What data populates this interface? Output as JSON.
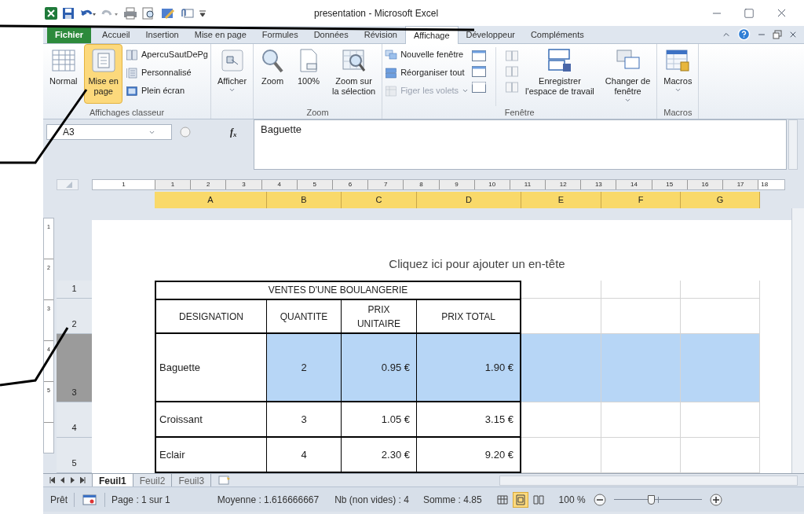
{
  "window": {
    "title": "presentation - Microsoft Excel"
  },
  "ribbon_tabs": [
    {
      "label": "Fichier",
      "kind": "file",
      "selected": false
    },
    {
      "label": "Accueil",
      "kind": "tab",
      "selected": false
    },
    {
      "label": "Insertion",
      "kind": "tab",
      "selected": false
    },
    {
      "label": "Mise en page",
      "kind": "tab",
      "selected": false
    },
    {
      "label": "Formules",
      "kind": "tab",
      "selected": false
    },
    {
      "label": "Données",
      "kind": "tab",
      "selected": false
    },
    {
      "label": "Révision",
      "kind": "tab",
      "selected": false
    },
    {
      "label": "Affichage",
      "kind": "tab",
      "selected": true
    },
    {
      "label": "Développeur",
      "kind": "tab",
      "selected": false
    },
    {
      "label": "Compléments",
      "kind": "tab",
      "selected": false
    }
  ],
  "ribbon_groups": [
    {
      "name": "Affichages classeur",
      "items": [
        {
          "kind": "large",
          "label": "Normal",
          "selected": false
        },
        {
          "kind": "large",
          "label": "Mise en\npage",
          "selected": true
        },
        {
          "kind": "stack",
          "entries": [
            {
              "label": "ApercuSautDePg",
              "disabled": false
            },
            {
              "label": "Personnalisé",
              "disabled": false
            },
            {
              "label": "Plein écran",
              "disabled": false
            }
          ]
        }
      ]
    },
    {
      "items": [
        {
          "kind": "large",
          "label": "Afficher",
          "dropdown": true,
          "selected": false
        }
      ]
    },
    {
      "name": "Zoom",
      "items": [
        {
          "kind": "large",
          "label": "Zoom",
          "selected": false
        },
        {
          "kind": "large",
          "label": "100%",
          "selected": false
        },
        {
          "kind": "large",
          "label": "Zoom sur\nla sélection",
          "selected": false
        }
      ]
    },
    {
      "name": "Fenêtre",
      "items": [
        {
          "kind": "stack",
          "entries": [
            {
              "label": "Nouvelle fenêtre",
              "disabled": false
            },
            {
              "label": "Réorganiser tout",
              "disabled": false
            },
            {
              "label": "Figer les volets",
              "disabled": true,
              "dropdown": true
            }
          ]
        },
        {
          "kind": "icons"
        },
        {
          "kind": "large",
          "label": "Enregistrer\nl'espace de travail",
          "selected": false
        },
        {
          "kind": "large",
          "label": "Changer de\nfenêtre",
          "dropdown": true,
          "selected": false
        }
      ]
    },
    {
      "name": "Macros",
      "items": [
        {
          "kind": "large",
          "label": "Macros",
          "dropdown": true,
          "selected": false
        }
      ]
    }
  ],
  "formula_bar": {
    "name_box": "A3",
    "function_label": "f$_{x}$",
    "formula": "Baguette"
  },
  "ruler_numbers": [
    "1",
    "1",
    "2",
    "3",
    "4",
    "5",
    "6",
    "7",
    "8",
    "9",
    "10",
    "11",
    "12",
    "13",
    "14",
    "15",
    "16",
    "17",
    "18"
  ],
  "vertical_ruler_numbers": [
    "1",
    "2",
    "3",
    "4",
    "5"
  ],
  "columns": [
    {
      "label": "A",
      "selected": true
    },
    {
      "label": "B",
      "selected": true
    },
    {
      "label": "C",
      "selected": true
    },
    {
      "label": "D",
      "selected": true
    },
    {
      "label": "E",
      "selected": true
    },
    {
      "label": "F",
      "selected": true
    },
    {
      "label": "G",
      "selected": true
    }
  ],
  "page_header_hint": "Cliquez ici pour ajouter un en-tête",
  "row_headers": [
    {
      "label": "1",
      "selected": false
    },
    {
      "label": "2",
      "selected": false
    },
    {
      "label": "3",
      "selected": true
    },
    {
      "label": "4",
      "selected": false
    },
    {
      "label": "5",
      "selected": false
    }
  ],
  "table": {
    "title": "VENTES D'UNE BOULANGERIE",
    "columns": [
      "DESIGNATION",
      "QUANTITE",
      "PRIX\nUNITAIRE",
      "PRIX TOTAL"
    ],
    "rows": [
      {
        "cells": [
          "Baguette",
          "2",
          "0.95 €",
          "1.90 €"
        ],
        "selected": true
      },
      {
        "cells": [
          "Croissant",
          "3",
          "1.05 €",
          "3.15 €"
        ],
        "selected": false
      },
      {
        "cells": [
          "Eclair",
          "4",
          "2.30 €",
          "9.20 €"
        ],
        "selected": false
      }
    ]
  },
  "sheet_tabs": [
    {
      "label": "Feuil1",
      "selected": true
    },
    {
      "label": "Feuil2",
      "selected": false
    },
    {
      "label": "Feuil3",
      "selected": false
    }
  ],
  "status_bar": {
    "mode": "Prêt",
    "page": "Page : 1 sur 1",
    "average": "Moyenne : 1.616666667",
    "count": "Nb (non vides) : 4",
    "sum": "Somme : 4.85",
    "views": [
      {
        "kind": "normal",
        "selected": false
      },
      {
        "kind": "layout",
        "selected": true
      },
      {
        "kind": "break",
        "selected": false
      }
    ],
    "zoom": "100 %",
    "zoom_slider": {
      "level": 0.42
    }
  }
}
